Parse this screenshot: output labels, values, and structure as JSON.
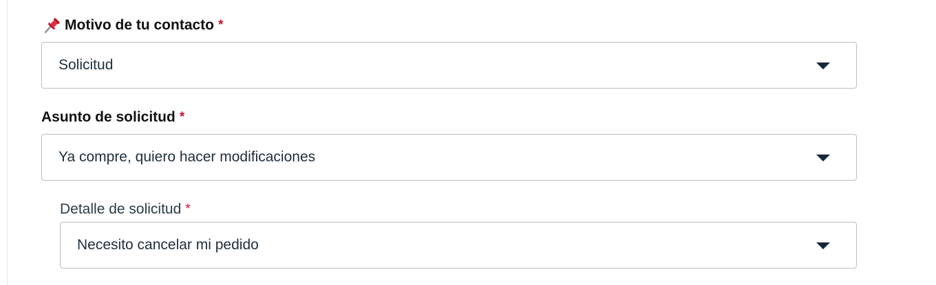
{
  "form": {
    "motivo": {
      "label": "Motivo de tu contacto",
      "required_mark": "*",
      "icon": "pushpin-icon",
      "value": "Solicitud"
    },
    "asunto": {
      "label": "Asunto de solicitud",
      "required_mark": "*",
      "value": "Ya compre, quiero hacer modificaciones"
    },
    "detalle": {
      "label": "Detalle de solicitud",
      "required_mark": "*",
      "value": "Necesito cancelar mi pedido"
    }
  },
  "colors": {
    "required": "#c8102e",
    "border": "#b8bfc6",
    "caret": "#17263a",
    "text": "#1f2e3a"
  }
}
